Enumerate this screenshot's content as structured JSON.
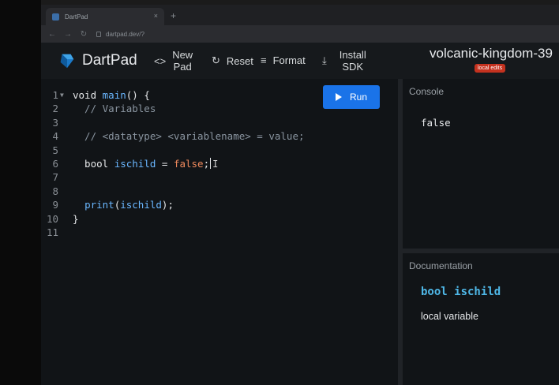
{
  "browser": {
    "tab_title": "DartPad",
    "tab_close": "×",
    "new_tab": "+",
    "url": "dartpad.dev/?"
  },
  "header": {
    "app_name": "DartPad",
    "new_pad_line1": "New",
    "new_pad_line2": "Pad",
    "reset_label": "Reset",
    "format_label": "Format",
    "install_line1": "Install",
    "install_line2": "SDK",
    "pad_title": "volcanic-kingdom-39",
    "badge": "local edits"
  },
  "editor": {
    "run_label": "Run",
    "lines": [
      {
        "n": "1",
        "fold": "▼",
        "parts": [
          {
            "t": "void ",
            "c": "c-kw"
          },
          {
            "t": "main",
            "c": "c-fn"
          },
          {
            "t": "() {",
            "c": "c-kw"
          }
        ]
      },
      {
        "n": "2",
        "parts": [
          {
            "t": "  // Variables",
            "c": "c-comment"
          }
        ]
      },
      {
        "n": "3",
        "parts": []
      },
      {
        "n": "4",
        "parts": [
          {
            "t": "  // <datatype> <variablename> = value;",
            "c": "c-comment"
          }
        ]
      },
      {
        "n": "5",
        "parts": []
      },
      {
        "n": "6",
        "parts": [
          {
            "t": "  bool ",
            "c": "c-kw"
          },
          {
            "t": "ischild",
            "c": "c-var"
          },
          {
            "t": " = ",
            "c": "c-kw"
          },
          {
            "t": "false",
            "c": "c-str"
          },
          {
            "t": ";",
            "c": "c-kw"
          }
        ],
        "cursor": true
      },
      {
        "n": "7",
        "parts": []
      },
      {
        "n": "8",
        "parts": []
      },
      {
        "n": "9",
        "parts": [
          {
            "t": "  ",
            "c": "c-kw"
          },
          {
            "t": "print",
            "c": "c-fn"
          },
          {
            "t": "(",
            "c": "c-kw"
          },
          {
            "t": "ischild",
            "c": "c-var"
          },
          {
            "t": ");",
            "c": "c-kw"
          }
        ]
      },
      {
        "n": "10",
        "parts": [
          {
            "t": "}",
            "c": "c-kw"
          }
        ]
      },
      {
        "n": "11",
        "parts": []
      }
    ]
  },
  "console": {
    "title": "Console",
    "output": "false"
  },
  "docs": {
    "title": "Documentation",
    "heading": "bool ischild",
    "body": "local variable"
  },
  "colors": {
    "run_button": "#1a73e8",
    "badge": "#c5321f",
    "doc_heading": "#4fb8e8"
  }
}
